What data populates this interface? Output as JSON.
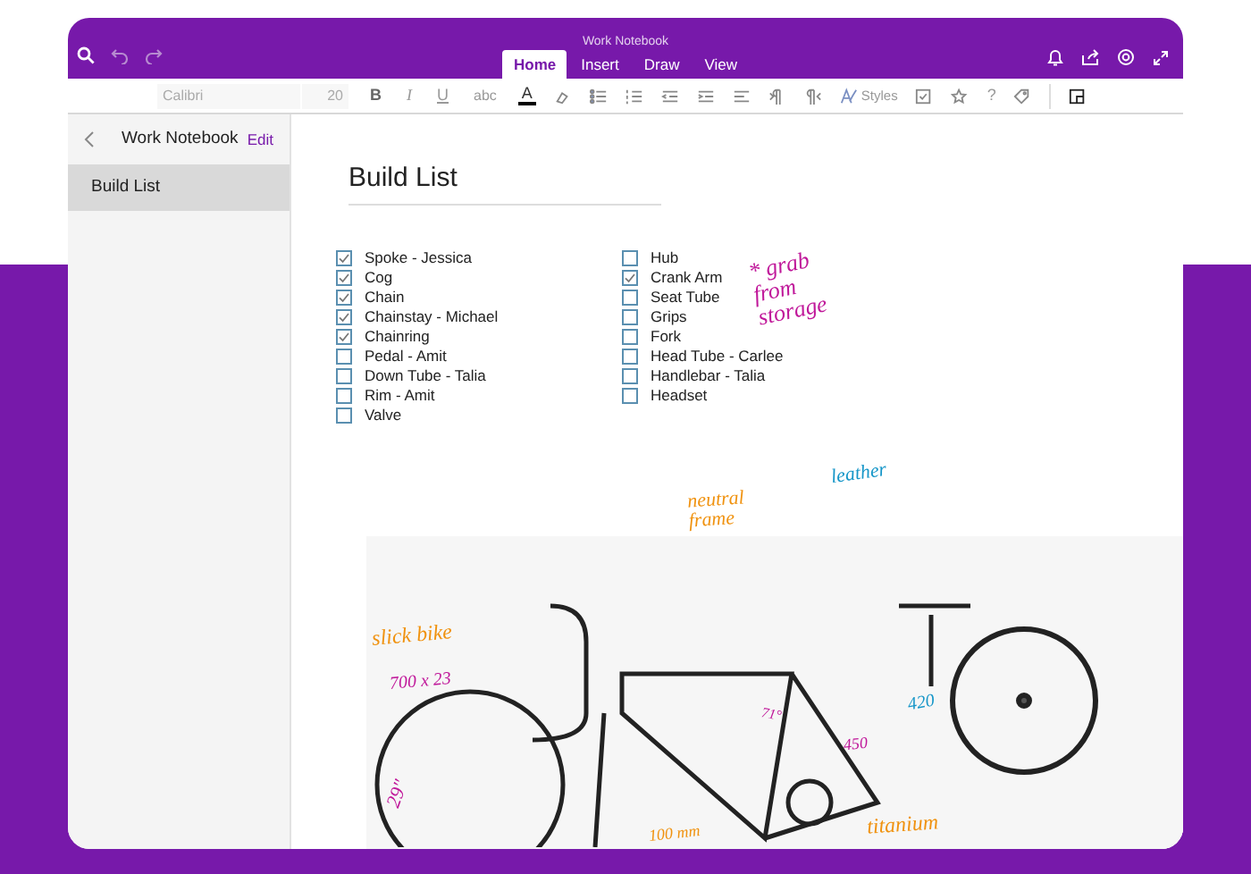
{
  "window": {
    "title": "Work Notebook"
  },
  "tabs": [
    {
      "label": "Home",
      "selected": true
    },
    {
      "label": "Insert",
      "selected": false
    },
    {
      "label": "Draw",
      "selected": false
    },
    {
      "label": "View",
      "selected": false
    }
  ],
  "toolbar": {
    "font": "Calibri",
    "size": "20",
    "format_buttons": [
      "B",
      "I",
      "U",
      "abc",
      "A"
    ],
    "styles": "Styles",
    "help": "?"
  },
  "sidebar": {
    "title": "Work Notebook",
    "edit": "Edit",
    "pages": [
      {
        "label": "Build List",
        "selected": true
      }
    ]
  },
  "page": {
    "title": "Build List",
    "column_1": [
      {
        "text": "Spoke - Jessica",
        "checked": true
      },
      {
        "text": "Cog",
        "checked": true
      },
      {
        "text": "Chain",
        "checked": true
      },
      {
        "text": "Chainstay - Michael",
        "checked": true
      },
      {
        "text": "Chainring",
        "checked": true
      },
      {
        "text": "Pedal - Amit",
        "checked": false
      },
      {
        "text": "Down Tube - Talia",
        "checked": false
      },
      {
        "text": "Rim - Amit",
        "checked": false
      },
      {
        "text": "Valve",
        "checked": false
      }
    ],
    "column_2": [
      {
        "text": "Hub",
        "checked": false
      },
      {
        "text": "Crank Arm",
        "checked": true
      },
      {
        "text": "Seat Tube",
        "checked": false
      },
      {
        "text": "Grips",
        "checked": false
      },
      {
        "text": "Fork",
        "checked": false
      },
      {
        "text": "Head Tube - Carlee",
        "checked": false
      },
      {
        "text": "Handlebar - Talia",
        "checked": false
      },
      {
        "text": "Headset",
        "checked": false
      }
    ],
    "ink_notes": [
      {
        "text": "* grab from storage",
        "color": "#c0189a"
      },
      {
        "text": "neutral frame",
        "color": "#f0920f"
      },
      {
        "text": "leather",
        "color": "#1696c8"
      },
      {
        "text": "slick bike",
        "color": "#f0920f"
      },
      {
        "text": "700 x 23",
        "color": "#c0189a"
      },
      {
        "text": "29\"",
        "color": "#c0189a"
      },
      {
        "text": "71°",
        "color": "#c0189a"
      },
      {
        "text": "450",
        "color": "#c0189a"
      },
      {
        "text": "420",
        "color": "#1696c8"
      },
      {
        "text": "100 mm",
        "color": "#f0920f"
      },
      {
        "text": "titanium",
        "color": "#f0920f"
      }
    ]
  }
}
